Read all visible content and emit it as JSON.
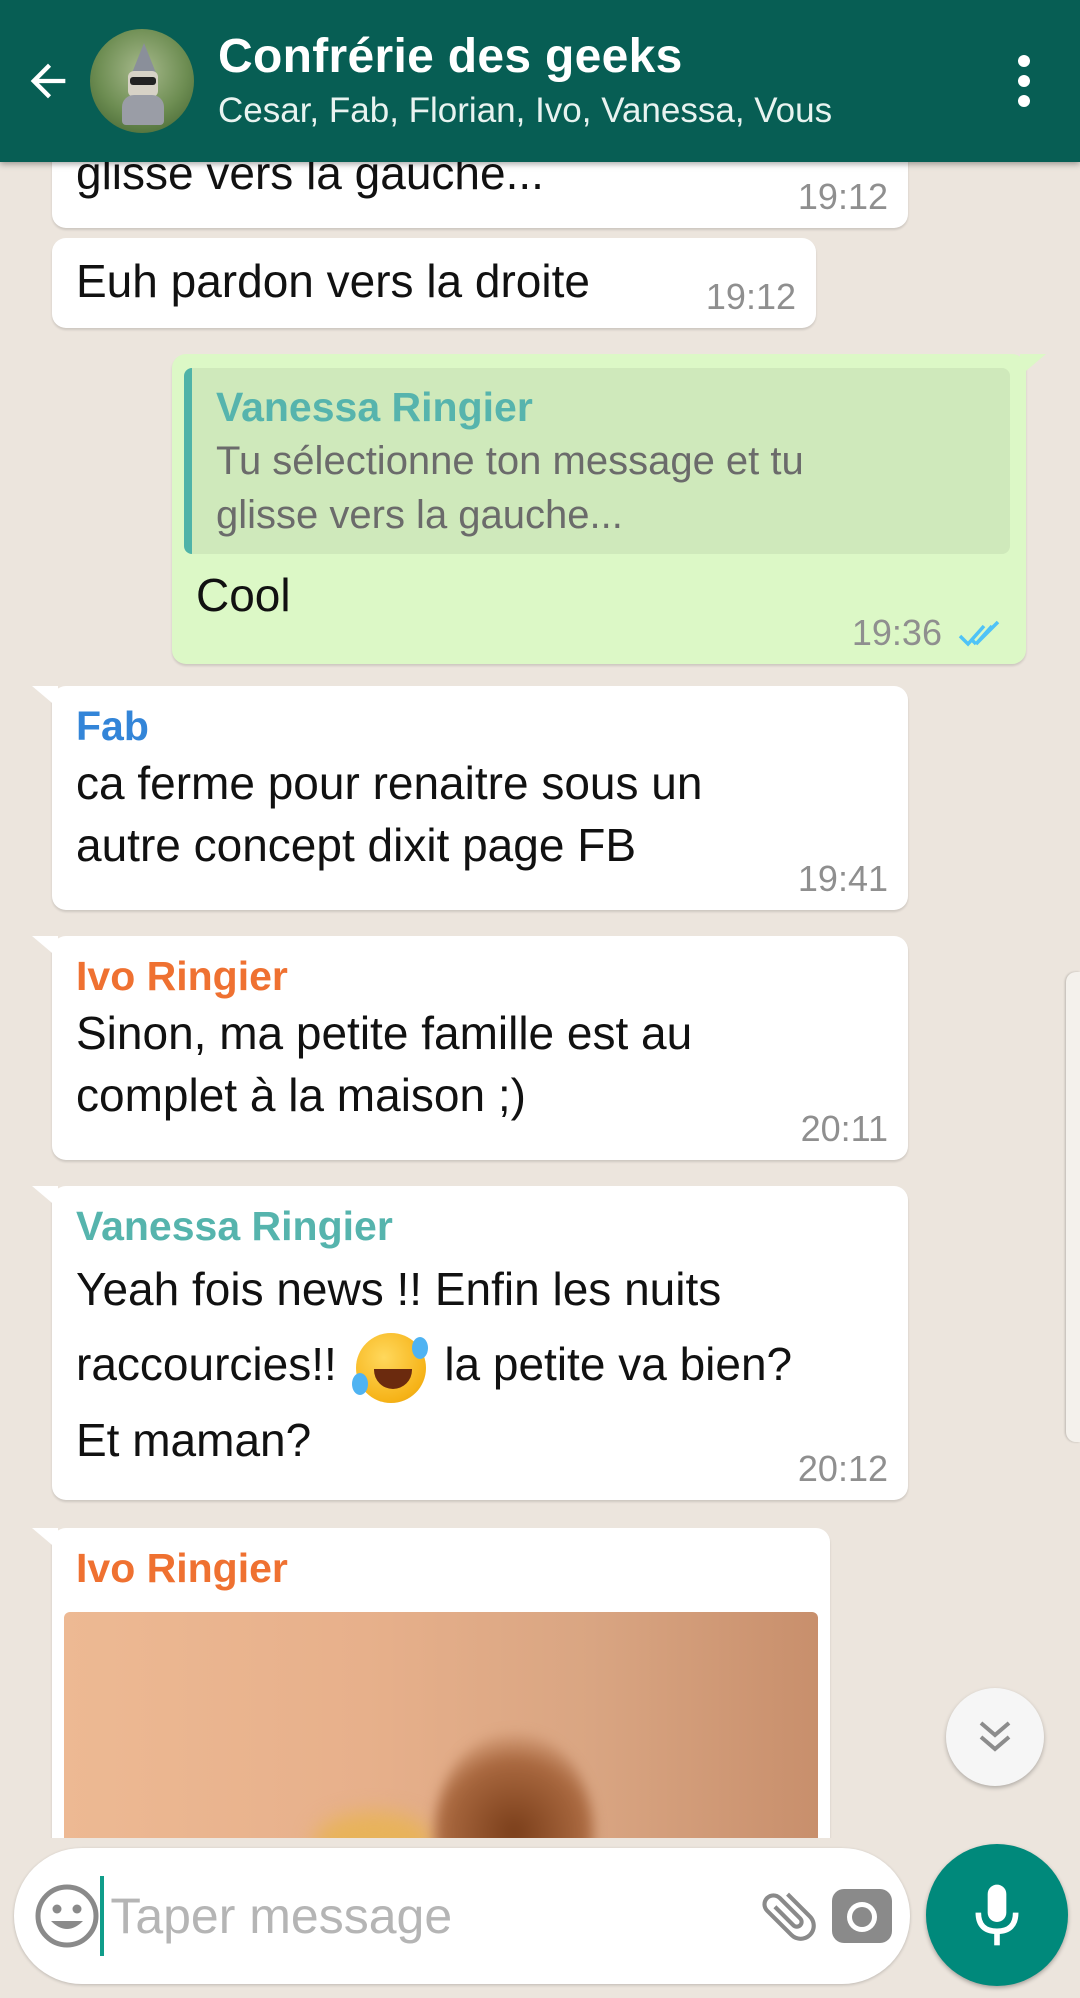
{
  "colors": {
    "header": "#075e54",
    "outgoing_bubble": "#dcf8c6",
    "incoming_bubble": "#ffffff",
    "accent": "#00897b",
    "read_ticks": "#4fc3f7",
    "sender_fab": "#3385d8",
    "sender_ivo": "#ef7131",
    "sender_vanessa": "#56b4ad"
  },
  "header": {
    "title": "Confrérie des geeks",
    "members": "Cesar, Fab, Florian, Ivo, Vanessa, Vous",
    "back_icon": "arrow-left-icon",
    "menu_icon": "more-vert-icon"
  },
  "messages": [
    {
      "direction": "in",
      "sender": "",
      "text": "glisse vers la gauche...",
      "time": "19:12"
    },
    {
      "direction": "in",
      "sender": "",
      "text": "Euh pardon vers la droite",
      "time": "19:12"
    },
    {
      "direction": "out",
      "quote": {
        "sender": "Vanessa Ringier",
        "text_line1": "Tu sélectionne ton message et tu",
        "text_line2": "glisse vers la gauche..."
      },
      "text": "Cool",
      "time": "19:36",
      "status": "read"
    },
    {
      "direction": "in",
      "sender": "Fab",
      "text_line1": "ca ferme pour renaitre sous un",
      "text_line2": "autre concept dixit page FB",
      "time": "19:41"
    },
    {
      "direction": "in",
      "sender": "Ivo Ringier",
      "text_line1": "Sinon, ma petite famille est au",
      "text_line2": "complet à la maison ;)",
      "time": "20:11"
    },
    {
      "direction": "in",
      "sender": "Vanessa Ringier",
      "text_line1": "Yeah fois news !! Enfin les nuits",
      "text_line2a": "raccourcies!!",
      "emoji": "rolling-on-floor-laughing-emoji",
      "text_line2b": "la petite va bien?",
      "text_line3": "Et maman?",
      "time": "20:12"
    },
    {
      "direction": "in",
      "sender": "Ivo Ringier",
      "type": "image"
    }
  ],
  "input": {
    "placeholder": "Taper message",
    "emoji_icon": "emoji-icon",
    "attach_icon": "paperclip-icon",
    "camera_icon": "camera-icon",
    "mic_icon": "microphone-icon"
  },
  "scroll_down_icon": "double-chevron-down-icon"
}
